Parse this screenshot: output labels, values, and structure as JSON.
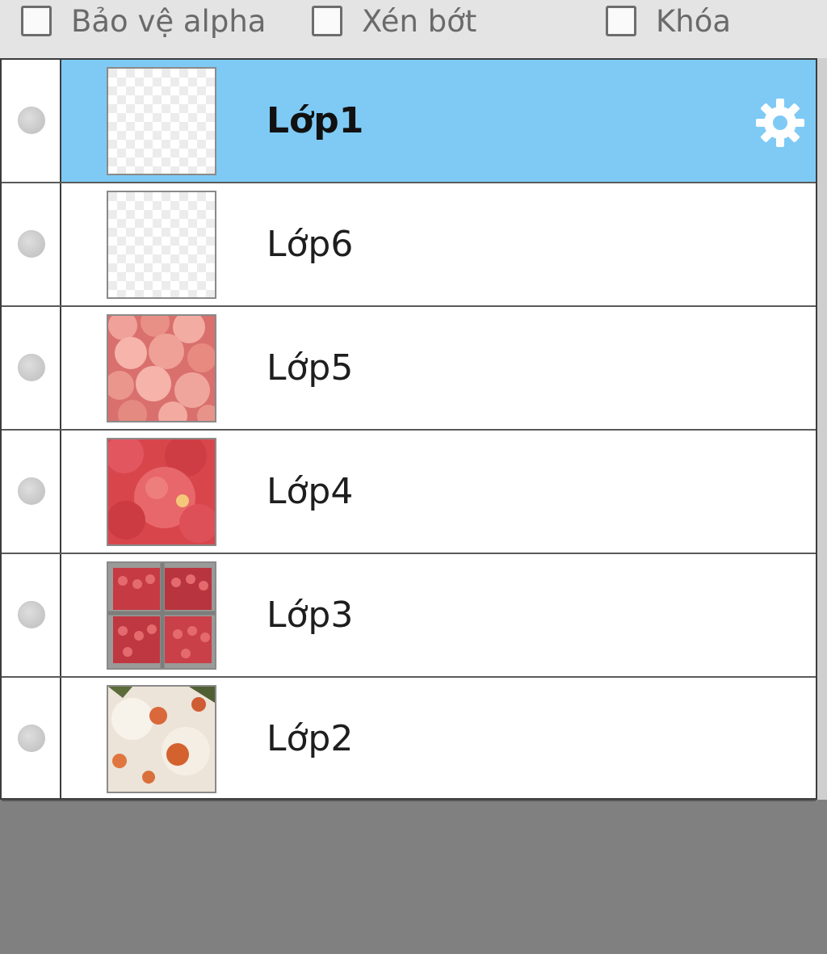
{
  "toolbar": {
    "options": [
      {
        "label": "Bảo vệ alpha",
        "checked": false
      },
      {
        "label": "Xén bớt",
        "checked": false
      },
      {
        "label": "Khóa",
        "checked": false
      }
    ]
  },
  "layers": [
    {
      "name": "Lớp1",
      "selected": true,
      "visible": false,
      "thumbnail": "transparent-checkerboard",
      "icon": "gear-icon"
    },
    {
      "name": "Lớp6",
      "selected": false,
      "visible": false,
      "thumbnail": "transparent-checkerboard"
    },
    {
      "name": "Lớp5",
      "selected": false,
      "visible": false,
      "thumbnail": "pink-strawberries"
    },
    {
      "name": "Lớp4",
      "selected": false,
      "visible": false,
      "thumbnail": "red-strawberry-closeup"
    },
    {
      "name": "Lớp3",
      "selected": false,
      "visible": false,
      "thumbnail": "strawberry-crates"
    },
    {
      "name": "Lớp2",
      "selected": false,
      "visible": false,
      "thumbnail": "strawberries-on-cream"
    }
  ],
  "colors": {
    "selected_row": "#7ecaf5",
    "panel_background": "#808080",
    "toolbar_background": "#e4e4e4"
  }
}
